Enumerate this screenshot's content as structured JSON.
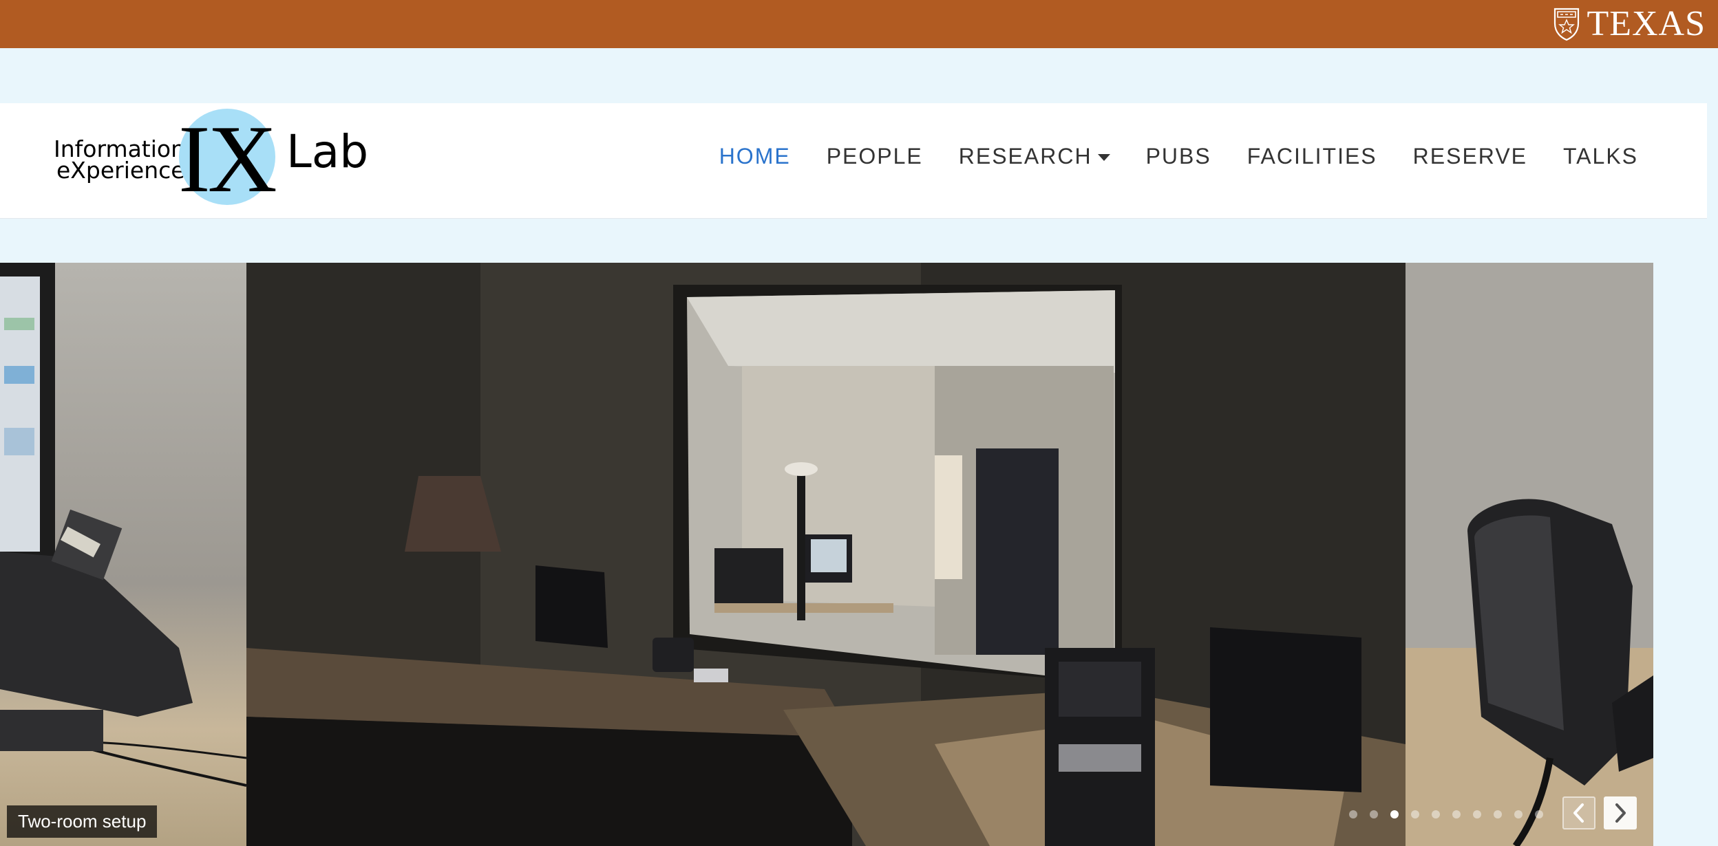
{
  "top_bar": {
    "brand_text": "TEXAS",
    "background_color": "#b15b22"
  },
  "logo": {
    "line1": "Information",
    "line2": "eXperience",
    "big_letters": "IX",
    "suffix": "Lab",
    "circle_color": "#a8dff7"
  },
  "nav": {
    "items": [
      {
        "label": "HOME",
        "active": true
      },
      {
        "label": "PEOPLE"
      },
      {
        "label": "RESEARCH",
        "has_dropdown": true
      },
      {
        "label": "PUBS"
      },
      {
        "label": "FACILITIES"
      },
      {
        "label": "RESERVE"
      },
      {
        "label": "TALKS"
      }
    ],
    "active_color": "#2a73cc"
  },
  "slider": {
    "caption": "Two-room setup",
    "total_slides": 10,
    "active_slide": 3,
    "prev_icon": "chevron-left-icon",
    "next_icon": "chevron-right-icon"
  }
}
